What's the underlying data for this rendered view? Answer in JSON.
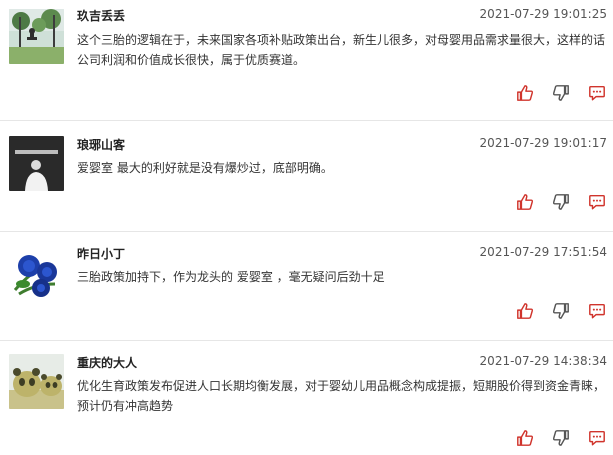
{
  "comments": [
    {
      "username": "玖吉丢丢",
      "timestamp": "2021-07-29 19:01:25",
      "text": "这个三胎的逻辑在于，未来国家各项补贴政策出台，新生儿很多，对母婴用品需求量很大，这样的话公司利润和价值成长很快，属于优质赛道。",
      "avatar_icon": "swing-photo"
    },
    {
      "username": "琅琊山客",
      "timestamp": "2021-07-29 19:01:17",
      "stock_tag": "爱婴室",
      "text": " 最大的利好就是没有爆炒过，底部明确。",
      "avatar_icon": "grayscale-person-photo"
    },
    {
      "username": "昨日小丁",
      "timestamp": "2021-07-29 17:51:54",
      "text_before": "三胎政策加持下，作为龙头的 ",
      "stock_tag": "爱婴室",
      "text_after": " ，毫无疑问后劲十足",
      "avatar_icon": "blue-roses-photo"
    },
    {
      "username": "重庆的大人",
      "timestamp": "2021-07-29 14:38:34",
      "text": "优化生育政策发布促进人口长期均衡发展，对于婴幼儿用品概念构成提振，短期股价得到资金青睐，预计仍有冲高趋势",
      "avatar_icon": "panda-topiary-photo"
    }
  ],
  "icons": {
    "like": "thumbs-up-icon",
    "dislike": "thumbs-down-icon",
    "reply": "comment-icon"
  },
  "colors": {
    "action_icon": "#d0342c",
    "divider": "#e6e6e6"
  }
}
